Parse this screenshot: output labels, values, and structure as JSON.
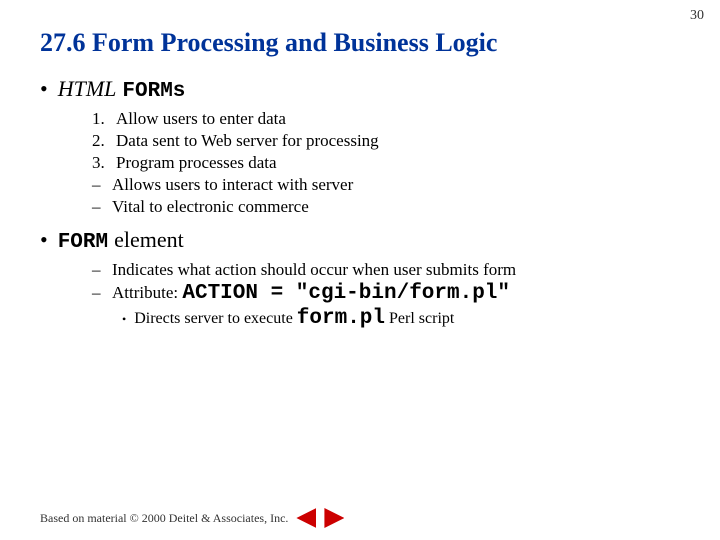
{
  "page": {
    "number": "30",
    "title": "27.6 Form Processing and Business Logic",
    "section1": {
      "bullet": "• HTML FORMs",
      "html_text": "HTML",
      "forms_text": "FORMs",
      "items": [
        {
          "num": "1.",
          "text": "Allow users to enter data"
        },
        {
          "num": "2.",
          "text": "Data sent to Web server for processing"
        },
        {
          "num": "3.",
          "text": "Program processes data"
        },
        {
          "dash": "–",
          "text": "Allows users to interact with server"
        },
        {
          "dash": "–",
          "text": "Vital to electronic commerce"
        }
      ]
    },
    "section2": {
      "bullet_prefix": "•",
      "form_text": "FORM",
      "bullet_suffix": " element",
      "items": [
        {
          "dash": "–",
          "text": "Indicates what action should occur when user submits form"
        },
        {
          "dash": "–",
          "text_prefix": "Attribute: ",
          "code": "ACTION = \"cgi-bin/form.pl\""
        }
      ],
      "sub_items": [
        {
          "bullet": "•",
          "text_prefix": "Directs server to execute ",
          "code": "form.pl",
          "text_suffix": " Perl script"
        }
      ]
    },
    "footer": {
      "text": "Based on material © 2000 Deitel & Associates, Inc."
    }
  }
}
